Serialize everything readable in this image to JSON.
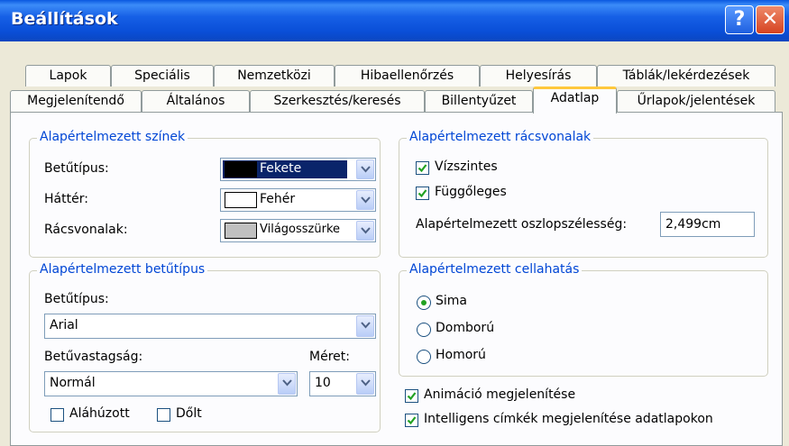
{
  "window": {
    "title": "Beállítások"
  },
  "titlebar": {
    "help_label": "?",
    "close_label": "✕"
  },
  "tabs_row1": [
    "Lapok",
    "Speciális",
    "Nemzetközi",
    "Hibaellenőrzés",
    "Helyesírás",
    "Táblák/lekérdezések"
  ],
  "tabs_row2": [
    "Megjelenítendő",
    "Általános",
    "Szerkesztés/keresés",
    "Billentyűzet",
    "Adatlap",
    "Űrlapok/jelentések"
  ],
  "colors_group": {
    "legend": "Alapértelmezett színek",
    "font_label": "Betűtípus:",
    "font_value": "Fekete",
    "font_color": "#000000",
    "background_label": "Háttér:",
    "background_value": "Fehér",
    "background_color": "#FFFFFF",
    "gridlines_label": "Rácsvonalak:",
    "gridlines_value": "Világosszürke",
    "gridlines_color": "#C0C0C0"
  },
  "gridlines_group": {
    "legend": "Alapértelmezett rácsvonalak",
    "horizontal_label": "Vízszintes",
    "horizontal_checked": true,
    "vertical_label": "Függőleges",
    "vertical_checked": true,
    "column_width_label": "Alapértelmezett oszlopszélesség:",
    "column_width_value": "2,499cm"
  },
  "font_group": {
    "legend": "Alapértelmezett betűtípus",
    "font_label": "Betűtípus:",
    "font_value": "Arial",
    "weight_label": "Betűvastagság:",
    "weight_value": "Normál",
    "size_label": "Méret:",
    "size_value": "10",
    "underline_label": "Aláhúzott",
    "underline_checked": false,
    "italic_label": "Dőlt",
    "italic_checked": false
  },
  "cell_effect_group": {
    "legend": "Alapértelmezett cellahatás",
    "options": [
      "Sima",
      "Domború",
      "Homorú"
    ],
    "selected": "Sima"
  },
  "options": {
    "animations_label": "Animáció megjelenítése",
    "animations_checked": true,
    "smart_tags_label": "Intelligens címkék megjelenítése adatlapokon",
    "smart_tags_checked": true
  },
  "theme": {
    "accent": "#0046D5",
    "titlebar": "#0A4FD8",
    "tab_highlight": "#FFC83C",
    "radio_dot": "#21A121",
    "check": "#21A121"
  }
}
